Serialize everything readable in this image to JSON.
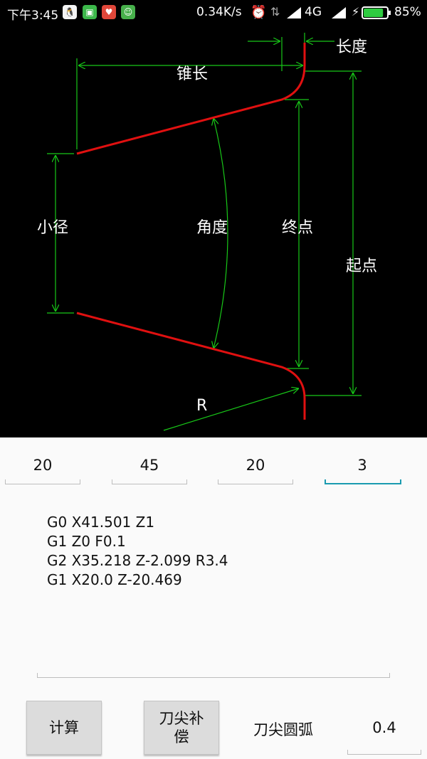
{
  "status_bar": {
    "time": "下午3:45",
    "net_speed": "0.34K/s",
    "network": "4G",
    "battery": "85%",
    "battery_level": 0.85,
    "icons": [
      "qq-icon",
      "sim-icon",
      "app-icon",
      "app-icon-2",
      "alarm-icon",
      "data-off-icon",
      "signal-icon",
      "signal-icon-2",
      "charging-icon",
      "battery-icon"
    ]
  },
  "diagram": {
    "labels": {
      "taper_length": "锥长",
      "length": "长度",
      "small_diameter": "小径",
      "angle": "角度",
      "end_point": "终点",
      "start_point": "起点",
      "radius": "R"
    },
    "colors": {
      "dimension": "#18c818",
      "profile": "#e01010",
      "background": "#000000"
    }
  },
  "inputs": {
    "field1": "20",
    "field2": "45",
    "field3": "20",
    "field4": "3"
  },
  "code": {
    "lines": [
      "G0 X41.501 Z1",
      "G1 Z0 F0.1",
      "G2 X35.218 Z-2.099 R3.4",
      "G1 X20.0 Z-20.469"
    ]
  },
  "buttons": {
    "calculate": "计算",
    "tool_comp": "刀尖补偿"
  },
  "tip_arc": {
    "label": "刀尖圆弧",
    "value": "0.4"
  },
  "accent_color": "#1a9bb0"
}
